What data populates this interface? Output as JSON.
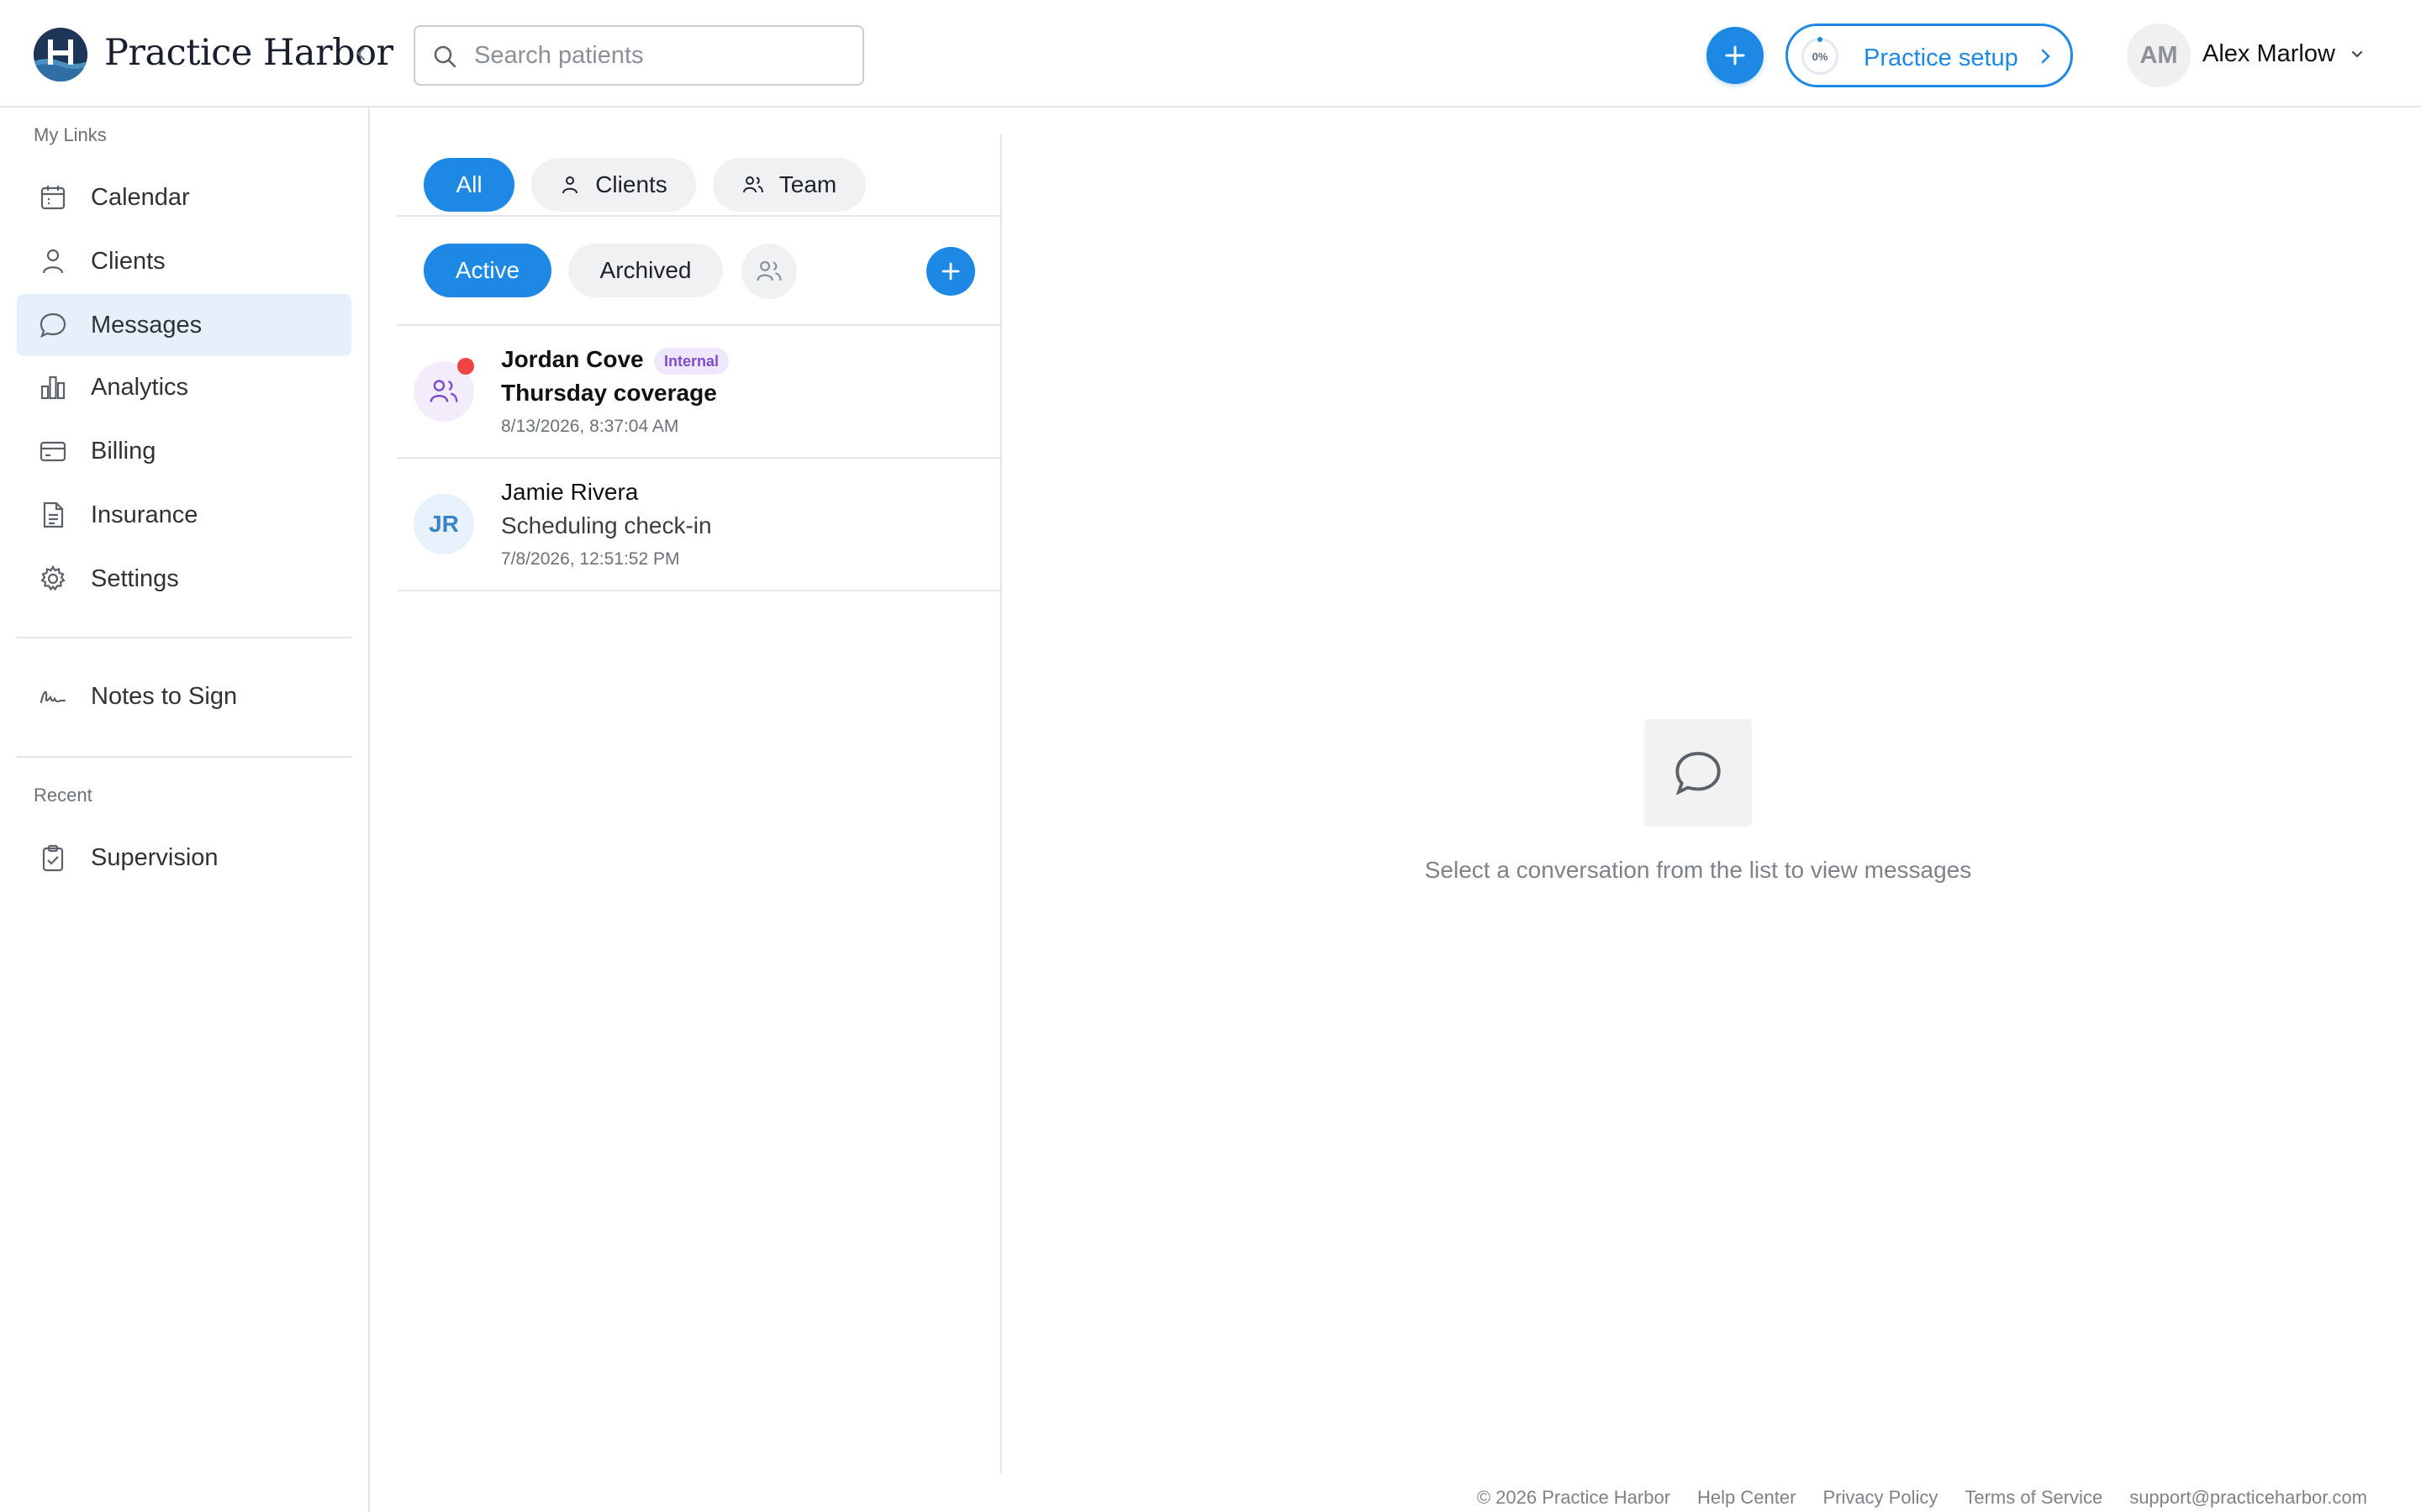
{
  "header": {
    "app_name": "Practice Harbor",
    "search_placeholder": "Search patients",
    "setup": {
      "label": "Practice setup",
      "progress": "0%"
    },
    "user": {
      "initials": "AM",
      "name": "Alex Marlow"
    }
  },
  "sidebar": {
    "section_my_links": "My Links",
    "items": [
      {
        "label": "Calendar",
        "icon": "calendar-icon"
      },
      {
        "label": "Clients",
        "icon": "person-icon"
      },
      {
        "label": "Messages",
        "icon": "chat-bubble-icon",
        "active": true
      },
      {
        "label": "Analytics",
        "icon": "bar-chart-icon"
      },
      {
        "label": "Billing",
        "icon": "credit-card-icon"
      },
      {
        "label": "Insurance",
        "icon": "document-icon"
      },
      {
        "label": "Settings",
        "icon": "gear-icon"
      }
    ],
    "notes": {
      "label": "Notes to Sign",
      "icon": "signature-icon"
    },
    "section_recent": "Recent",
    "recent": [
      {
        "label": "Supervision",
        "icon": "clipboard-check-icon"
      }
    ]
  },
  "messages": {
    "type_filters": [
      "All",
      "Clients",
      "Team"
    ],
    "status_filters": [
      "Active",
      "Archived"
    ],
    "conversations": [
      {
        "name": "Jordan Cove",
        "badge": "Internal",
        "subject": "Thursday coverage",
        "time": "8/13/2026, 8:37:04 AM",
        "unread": true,
        "avatar": "group-icon"
      },
      {
        "name": "Jamie Rivera",
        "initials": "JR",
        "subject": "Scheduling check-in",
        "time": "7/8/2026, 12:51:52 PM",
        "unread": false
      }
    ],
    "empty_state": "Select a conversation from the list to view messages"
  },
  "footer": {
    "copyright": "© 2026 Practice Harbor",
    "links": [
      "Help Center",
      "Privacy Policy",
      "Terms of Service",
      "support@practiceharbor.com"
    ]
  },
  "colors": {
    "primary": "#1e88e5",
    "active_nav_bg": "#e6f0fa",
    "unread_dot": "#ef4444",
    "internal_badge": "#7c4dcc"
  }
}
